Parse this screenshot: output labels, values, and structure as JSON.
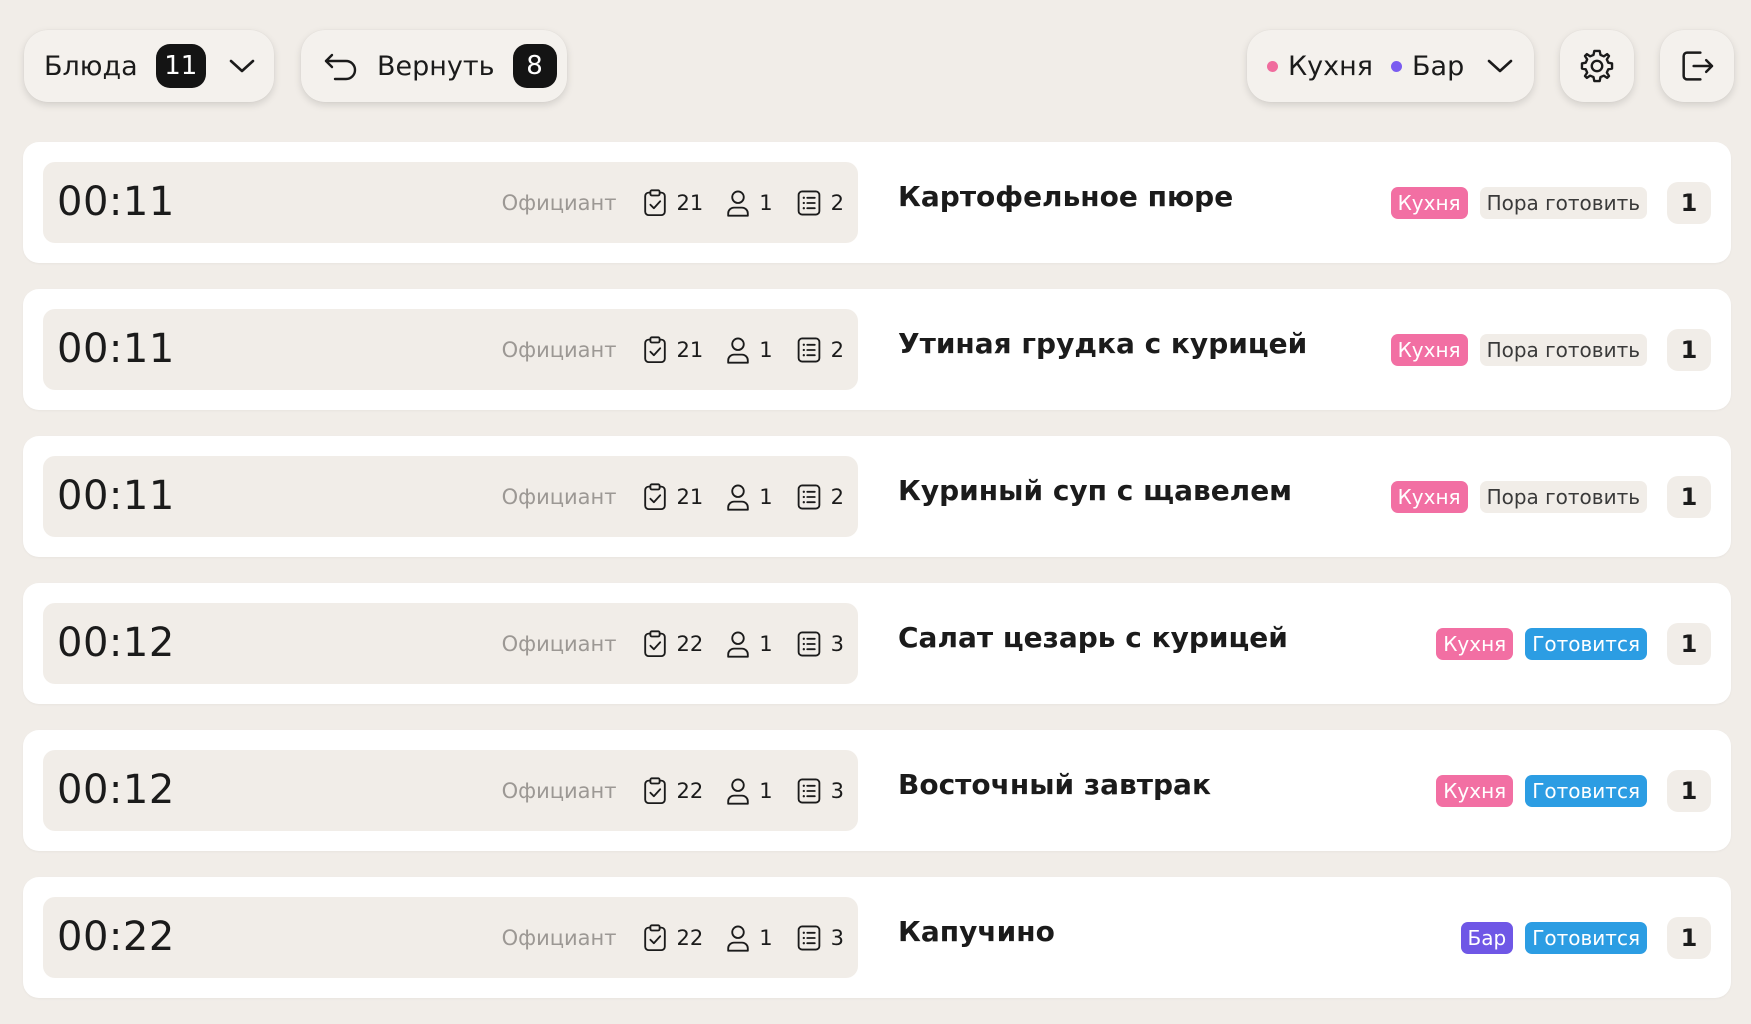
{
  "header": {
    "dishes": {
      "label": "Блюда",
      "count": "11"
    },
    "return": {
      "label": "Вернуть",
      "count": "8"
    },
    "stations": [
      {
        "label": "Кухня",
        "color": "#f06c9e"
      },
      {
        "label": "Бар",
        "color": "#7a5cf0"
      }
    ]
  },
  "orders": [
    {
      "time": "00:11",
      "waiter": "Официант",
      "table": "21",
      "guests": "1",
      "check": "2",
      "dish": "Картофельное пюре",
      "station": "Кухня",
      "status": "Пора готовить",
      "qty": "1"
    },
    {
      "time": "00:11",
      "waiter": "Официант",
      "table": "21",
      "guests": "1",
      "check": "2",
      "dish": "Утиная грудка с курицей",
      "station": "Кухня",
      "status": "Пора готовить",
      "qty": "1"
    },
    {
      "time": "00:11",
      "waiter": "Официант",
      "table": "21",
      "guests": "1",
      "check": "2",
      "dish": "Куриный суп с щавелем",
      "station": "Кухня",
      "status": "Пора готовить",
      "qty": "1"
    },
    {
      "time": "00:12",
      "waiter": "Официант",
      "table": "22",
      "guests": "1",
      "check": "3",
      "dish": "Салат цезарь с курицей",
      "station": "Кухня",
      "status": "Готовится",
      "qty": "1"
    },
    {
      "time": "00:12",
      "waiter": "Официант",
      "table": "22",
      "guests": "1",
      "check": "3",
      "dish": "Восточный завтрак",
      "station": "Кухня",
      "status": "Готовится",
      "qty": "1"
    },
    {
      "time": "00:22",
      "waiter": "Официант",
      "table": "22",
      "guests": "1",
      "check": "3",
      "dish": "Капучино",
      "station": "Бар",
      "status": "Готовится",
      "qty": "1"
    }
  ],
  "colors": {
    "kitchen": "#f26fa3",
    "bar": "#6f57e6",
    "cooking": "#2c9de3",
    "background": "#f1ede8"
  }
}
